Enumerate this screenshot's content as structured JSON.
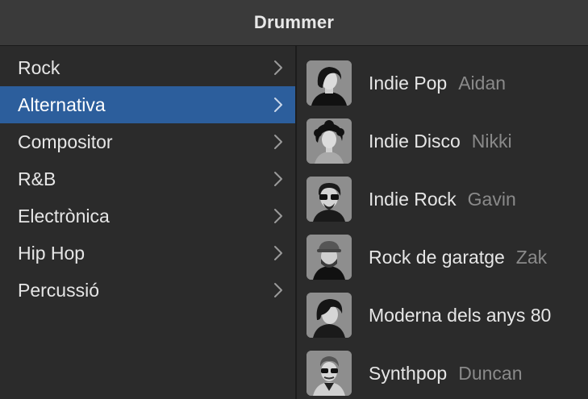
{
  "window": {
    "title": "Drummer"
  },
  "genres": [
    {
      "label": "Rock",
      "selected": false
    },
    {
      "label": "Alternativa",
      "selected": true
    },
    {
      "label": "Compositor",
      "selected": false
    },
    {
      "label": "R&B",
      "selected": false
    },
    {
      "label": "Electrònica",
      "selected": false
    },
    {
      "label": "Hip Hop",
      "selected": false
    },
    {
      "label": "Percussió",
      "selected": false
    }
  ],
  "drummers": [
    {
      "style": "Indie Pop",
      "name": "Aidan",
      "icon": "drummer-aidan-icon"
    },
    {
      "style": "Indie Disco",
      "name": "Nikki",
      "icon": "drummer-nikki-icon"
    },
    {
      "style": "Indie Rock",
      "name": "Gavin",
      "icon": "drummer-gavin-icon"
    },
    {
      "style": "Rock de garatge",
      "name": "Zak",
      "icon": "drummer-zak-icon"
    },
    {
      "style": "Moderna dels anys 80",
      "name": "",
      "icon": "drummer-avatar-icon"
    },
    {
      "style": "Synthpop",
      "name": "Duncan",
      "icon": "drummer-duncan-icon"
    }
  ],
  "colors": {
    "selection": "#2c5e9c",
    "background": "#2b2b2b",
    "header": "#3a3a3a",
    "secondary_text": "#8a8a8a"
  },
  "icons": {
    "chevron": "chevron-right-icon"
  }
}
